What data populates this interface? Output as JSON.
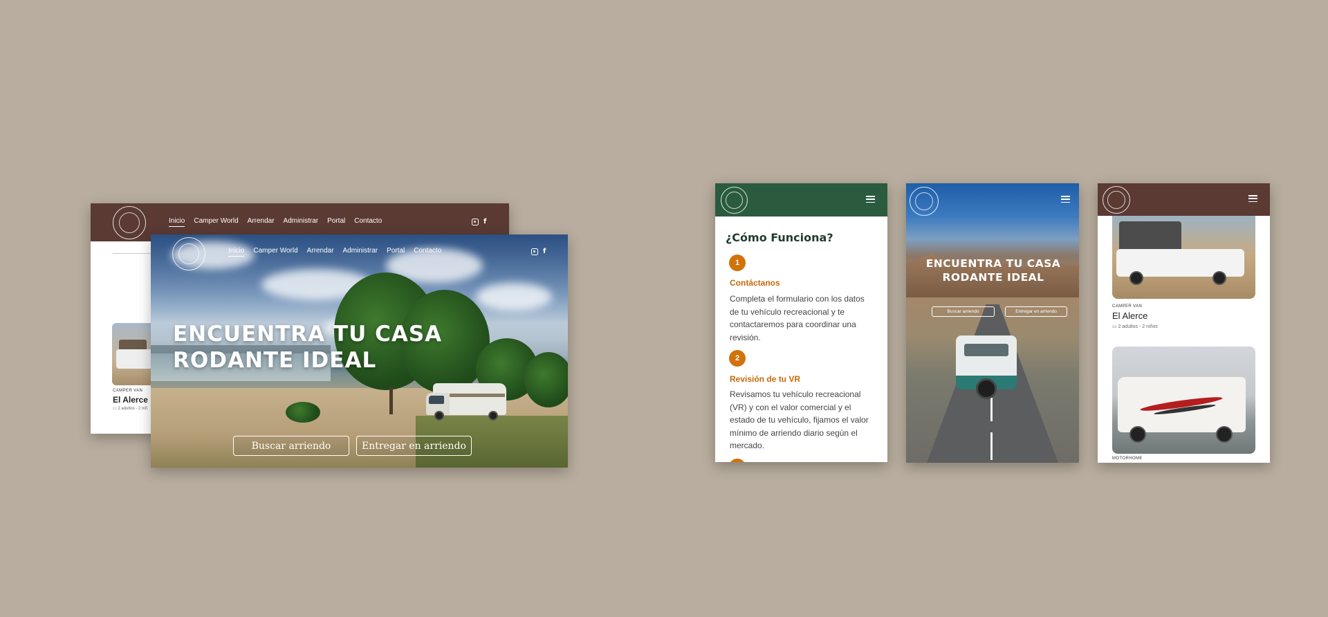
{
  "desktop": {
    "nav_items": [
      "Inicio",
      "Camper World",
      "Arrendar",
      "Administrar",
      "Portal",
      "Contacto"
    ],
    "hero_title": "ENCUENTRA TU CASA RODANTE IDEAL",
    "search_button": "Buscar arriendo",
    "deliver_button": "Entregar en arriendo",
    "back_card": {
      "category": "CAMPER VAN",
      "title": "El Alerce",
      "details": "2 adultos - 2 niñ"
    }
  },
  "mobile_steps": {
    "title": "¿Cómo Funciona?",
    "steps": [
      {
        "number": "1",
        "title": "Contáctanos",
        "text": "Completa el formulario con los datos de tu vehículo recreacional y te contactaremos para coordinar una revisión."
      },
      {
        "number": "2",
        "title": "Revisión de tu VR",
        "text": "Revisamos tu vehículo recreacional (VR) y con el valor comercial y el estado de tu vehículo, fijamos el valor mínimo de arriendo diario según el mercado."
      }
    ]
  },
  "mobile_hero": {
    "title": "ENCUENTRA TU CASA RODANTE IDEAL",
    "search_button": "Buscar arriendo",
    "deliver_button": "Entregar en arriendo"
  },
  "mobile_listing": {
    "card1": {
      "category": "CAMPER VAN",
      "title": "El Alerce",
      "details": "2 adultos - 2 niños"
    },
    "card2": {
      "category": "MOTORHOME"
    }
  },
  "icons": {
    "instagram": "instagram-icon",
    "facebook": "facebook-icon",
    "menu": "hamburger-icon",
    "bed": "bed-icon"
  },
  "colors": {
    "background": "#b8ad9e",
    "brown_nav": "#5a3a33",
    "green_nav": "#2b5b3f",
    "orange_accent": "#d2720a"
  }
}
